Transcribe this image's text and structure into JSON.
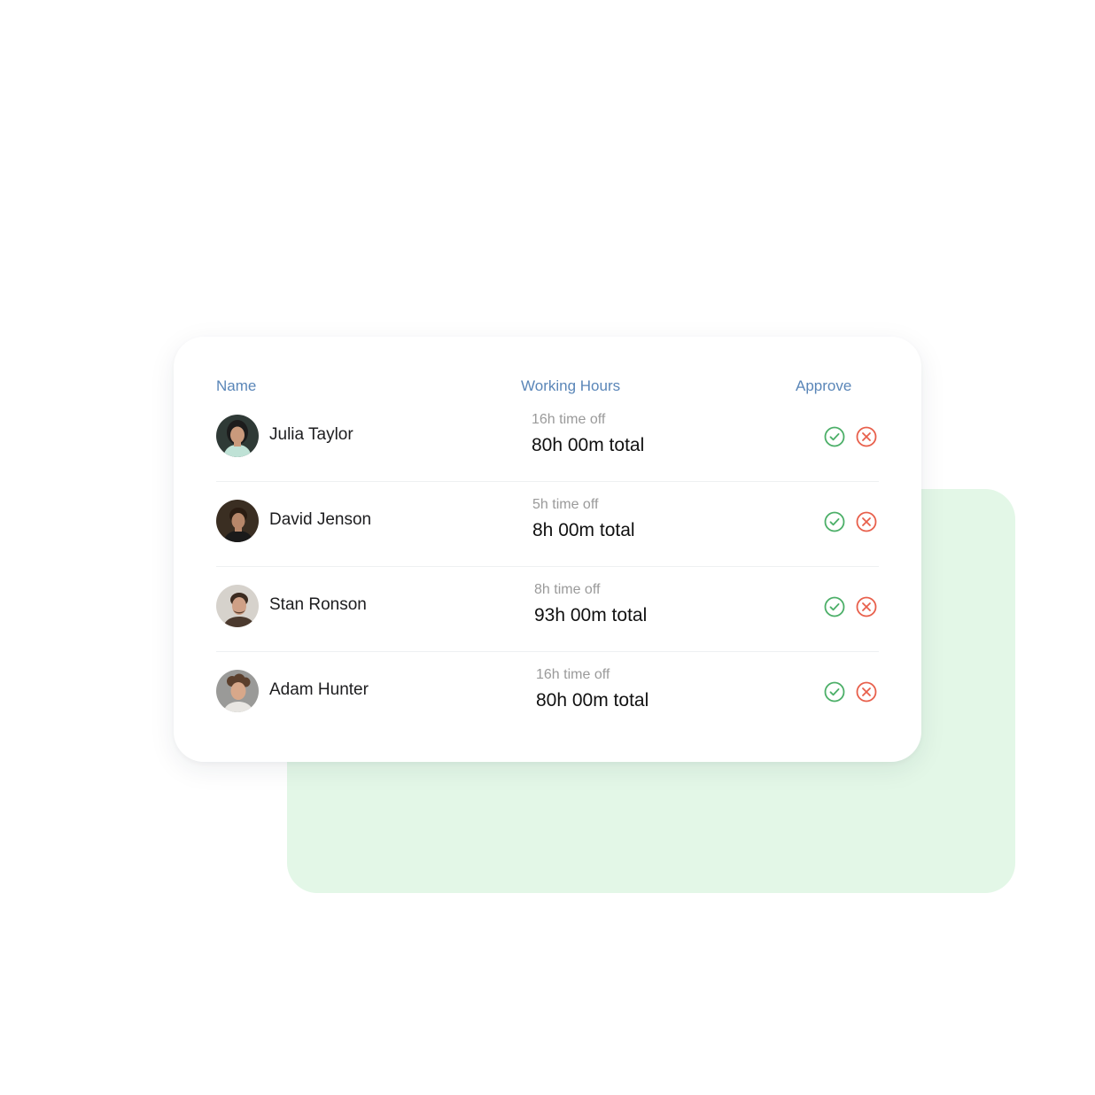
{
  "table": {
    "headers": {
      "name": "Name",
      "hours": "Working Hours",
      "approve": "Approve"
    },
    "rows": [
      {
        "name": "Julia Taylor",
        "time_off": "16h time off",
        "total": "80h 00m total",
        "avatar_icon": "avatar-photo-woman"
      },
      {
        "name": "David Jenson",
        "time_off": "5h time off",
        "total": "8h 00m total",
        "avatar_icon": "avatar-photo-man"
      },
      {
        "name": "Stan Ronson",
        "time_off": "8h time off",
        "total": "93h 00m total",
        "avatar_icon": "avatar-photo-man"
      },
      {
        "name": "Adam Hunter",
        "time_off": "16h time off",
        "total": "80h 00m total",
        "avatar_icon": "avatar-photo-man"
      }
    ]
  },
  "icons": {
    "approve": "check-circle-icon",
    "reject": "x-circle-icon"
  },
  "colors": {
    "header_text": "#5a86b8",
    "approve": "#4caf68",
    "reject": "#e8604c",
    "backdrop": "#e3f7e7"
  }
}
